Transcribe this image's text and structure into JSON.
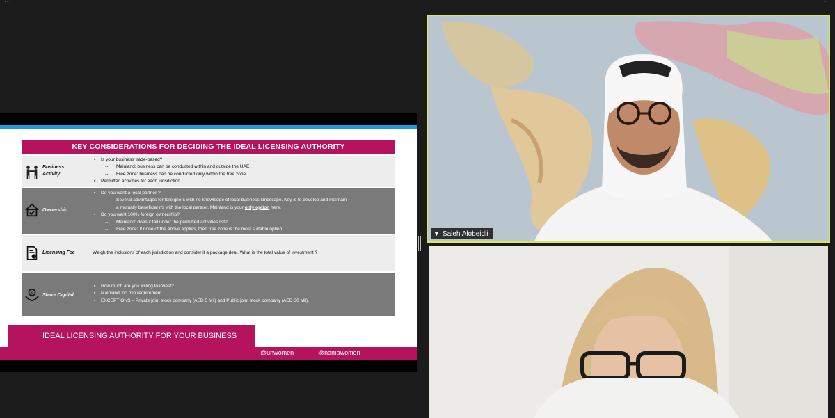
{
  "slide": {
    "title": "KEY CONSIDERATIONS FOR DECIDING THE IDEAL LICENSING AUTHORITY",
    "rows": [
      {
        "label_line1": "Business",
        "label_line2": "Activity",
        "icon": "handshake-icon",
        "bullets": [
          {
            "level": 1,
            "text": "Is your business trade-based?"
          },
          {
            "level": 2,
            "text": "Mainland: business can be conducted within and outside the UAE."
          },
          {
            "level": 2,
            "text": "Free zone: business can be conducted only within the free zone."
          },
          {
            "level": 1,
            "text": "Permitted activities for each jurisdiction."
          }
        ]
      },
      {
        "label_line1": "Ownership",
        "icon": "house-check-icon",
        "bullets": [
          {
            "level": 1,
            "text": "Do you want a local partner ?"
          },
          {
            "level": 2,
            "text": "Several advantages for foreigners with no knowledge of local business landscape. Key is to develop and maintain"
          },
          {
            "level": 3,
            "text_before": "a mutually beneficial r/s with the local partner. Mainland is your ",
            "text_emph": "only option",
            "text_after": " here."
          },
          {
            "level": 1,
            "text": "Do you want 100% foreign ownership?"
          },
          {
            "level": 2,
            "text": "Mainland: does it fall under the permitted activities list?"
          },
          {
            "level": 2,
            "text": "Free zone: If none of the above applies, then free zone is the most suitable option."
          }
        ]
      },
      {
        "label_line1": "Licensing Fee",
        "icon": "document-fee-icon",
        "text": "Weigh the inclusions of each jurisdiction and consider it a package deal. What is the total value of investment ?"
      },
      {
        "label_line1": "Share Capital",
        "icon": "money-hands-icon",
        "bullets": [
          {
            "level": 1,
            "text": "How much are you willing to invest?"
          },
          {
            "level": 1,
            "text": "Mainland: no min requirement."
          },
          {
            "level": 1,
            "text": "EXCEPTIONS – Private joint stock company (AED 5 Mil) and Public joint stock company (AED 30 Mil)."
          }
        ]
      }
    ],
    "bottom_title": "IDEAL LICENSING AUTHORITY FOR YOUR BUSINESS",
    "handle_1": "@unwomen",
    "handle_2": "@namawomen",
    "dash": "--"
  },
  "participants": [
    {
      "name": "Saleh Alobeidli",
      "speaking": true
    },
    {
      "name": ""
    }
  ],
  "colors": {
    "accent": "#b5135e",
    "slide_topbar": "#1f9ad6",
    "active_speaker_border": "#d6e84a"
  }
}
